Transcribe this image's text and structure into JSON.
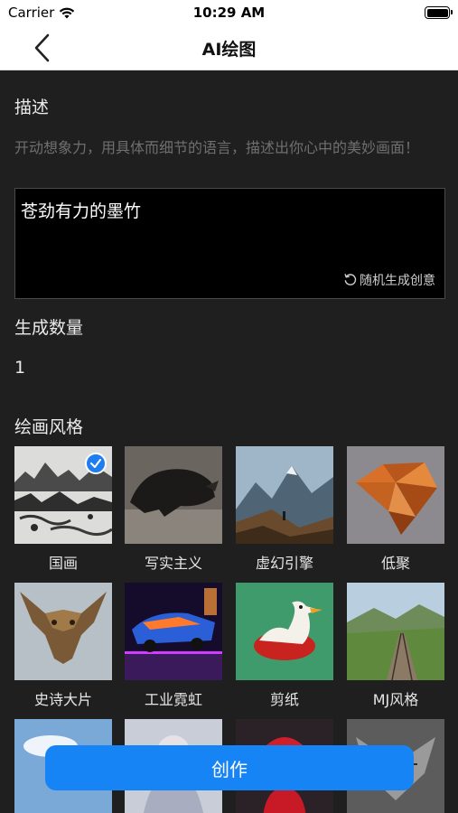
{
  "status_bar": {
    "carrier": "Carrier",
    "time": "10:29 AM"
  },
  "nav": {
    "title": "AI绘图"
  },
  "description": {
    "label": "描述",
    "hint": "开动想象力，用具体而细节的语言，描述出你心中的美妙画面！",
    "value": "苍劲有力的墨竹",
    "random_label": "随机生成创意"
  },
  "count": {
    "label": "生成数量",
    "value": "1"
  },
  "styles": {
    "label": "绘画风格",
    "selected": "国画",
    "items": [
      {
        "label": "国画",
        "image": "ink-landscape-painting"
      },
      {
        "label": "写实主义",
        "image": "realistic-boar"
      },
      {
        "label": "虚幻引擎",
        "image": "mountain-hiker"
      },
      {
        "label": "低聚",
        "image": "lowpoly-fox"
      },
      {
        "label": "史诗大片",
        "image": "bronze-dragon-mask"
      },
      {
        "label": "工业霓虹",
        "image": "neon-vehicle"
      },
      {
        "label": "剪纸",
        "image": "papercut-duck"
      },
      {
        "label": "MJ风格",
        "image": "valley-railway"
      },
      {
        "label": "",
        "image": "sky-clouds"
      },
      {
        "label": "",
        "image": "pale-figure"
      },
      {
        "label": "",
        "image": "santa-figure"
      },
      {
        "label": "",
        "image": "sketch-creature"
      }
    ]
  },
  "actions": {
    "create_label": "创作"
  },
  "colors": {
    "accent": "#1784f6",
    "background": "#1f1f1f",
    "selected_check": "#1e7df0"
  }
}
